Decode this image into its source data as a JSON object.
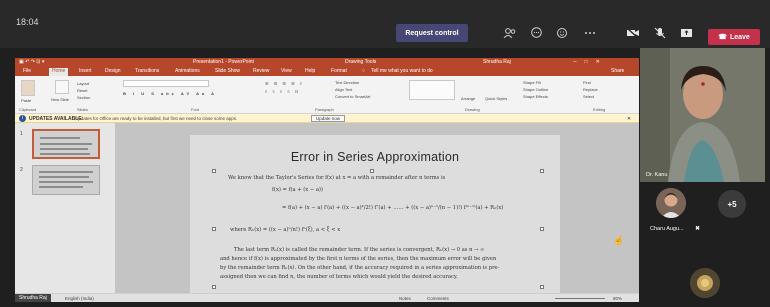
{
  "teams": {
    "time": "18:04",
    "request_control": "Request control",
    "leave": "Leave",
    "icons": [
      "people-icon",
      "chat-icon",
      "reactions-icon",
      "more-icon",
      "camera-off-icon",
      "mic-off-icon",
      "share-icon"
    ]
  },
  "ppt": {
    "title": "Presentation1 - PowerPoint",
    "tools_title": "Drawing Tools",
    "user": "Shrudha Raj",
    "tabs": [
      "File",
      "Home",
      "Insert",
      "Design",
      "Transitions",
      "Animations",
      "Slide Show",
      "Review",
      "View",
      "Help",
      "Format"
    ],
    "tell_me": "Tell me what you want to do",
    "share": "Share",
    "ribbon": {
      "paste": "Paste",
      "new_slide": "New Slide",
      "layout": "Layout",
      "reset": "Reset",
      "section": "Section",
      "groups": [
        "Clipboard",
        "Slides",
        "Font",
        "Paragraph",
        "Drawing",
        "Editing"
      ],
      "shapes": "Arrange",
      "quick_styles": "Quick Styles",
      "shape_fill": "Shape Fill",
      "shape_outline": "Shape Outline",
      "shape_effects": "Shape Effects",
      "find": "Find",
      "replace": "Replace",
      "select": "Select",
      "text_direction": "Text Direction",
      "align_text": "Align Text",
      "convert_smartart": "Convert to SmartArt"
    },
    "update_bar": {
      "title": "UPDATES AVAILABLE",
      "message": "Updates for Office are ready to be installed, but first we need to close some apps.",
      "button": "Update now"
    },
    "thumb_numbers": [
      "1",
      "2"
    ],
    "slide": {
      "title": "Error in Series Approximation",
      "line1": "We know that the Taylor's Series for  f(x)  at x = a with a remainder after n terms is",
      "line2": "f(x) = f(a + (x − a))",
      "line3": "= f(a) + (x − a) f′(a) + ((x − a)²/2!) f″(a) + …… + ((x − a)ⁿ⁻¹/(n − 1)!) f⁽ⁿ⁻¹⁾(a) + Rₙ(x)",
      "line4": "where        Rₙ(x) = ((x − a)ⁿ/n!) fⁿ(ξ),   a < ξ < x",
      "line5": "The last term  Rₙ(x)  is called the remainder term. If the series is convergent,  Rₙ(x) → 0 as n → ∞",
      "line6": "and hence if  f(x)  is approximated by the first n terms of the series, then the maximum error will be given",
      "line7": "by the remainder term  Rₙ(x). On the other hand, if the accuracy required in a series approximation is pre-",
      "line8": "assigned then we can find n, the number of terms which would yield the desired accuracy."
    },
    "status": {
      "presenter": "Shrudha Raj",
      "lang": "English (India)",
      "notes": "Notes",
      "comments": "Comments",
      "zoom": "80%"
    }
  },
  "participants": {
    "main_name": "Dr. Kanu",
    "second_name": "Charu Augu...",
    "more": "+5"
  },
  "colors": {
    "ppt_accent": "#b7472a",
    "leave": "#c4314b",
    "request": "#464775"
  }
}
